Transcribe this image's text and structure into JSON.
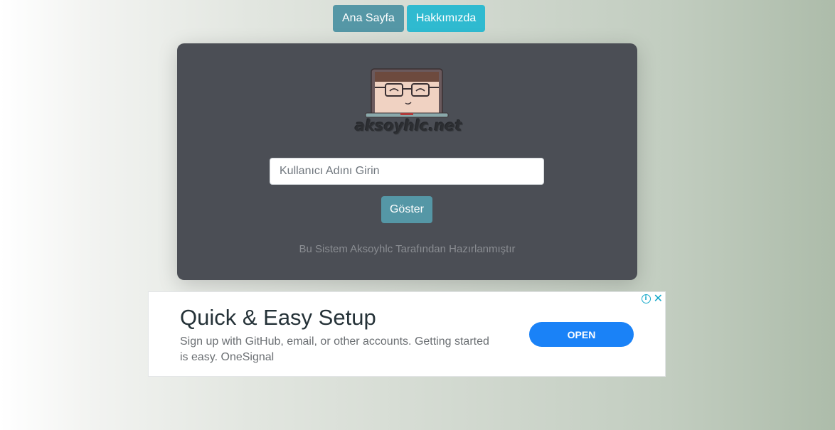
{
  "nav": {
    "home_label": "Ana Sayfa",
    "about_label": "Hakkımızda"
  },
  "card": {
    "logo_text": "aksoyhlc.net",
    "username_placeholder": "Kullanıcı Adını Girin",
    "username_value": "",
    "show_label": "Göster",
    "footer_note": "Bu Sistem Aksoyhlc Tarafından Hazırlanmıştır"
  },
  "ad": {
    "title": "Quick & Easy Setup",
    "body": "Sign up with GitHub, email, or other accounts. Getting started is easy. OneSignal",
    "open_label": "OPEN",
    "info_glyph": "i",
    "close_glyph": "✕"
  },
  "colors": {
    "primary": "#5597a6",
    "info": "#2fbad0",
    "card_bg": "#4b4e55",
    "ad_button": "#1a82f7"
  }
}
